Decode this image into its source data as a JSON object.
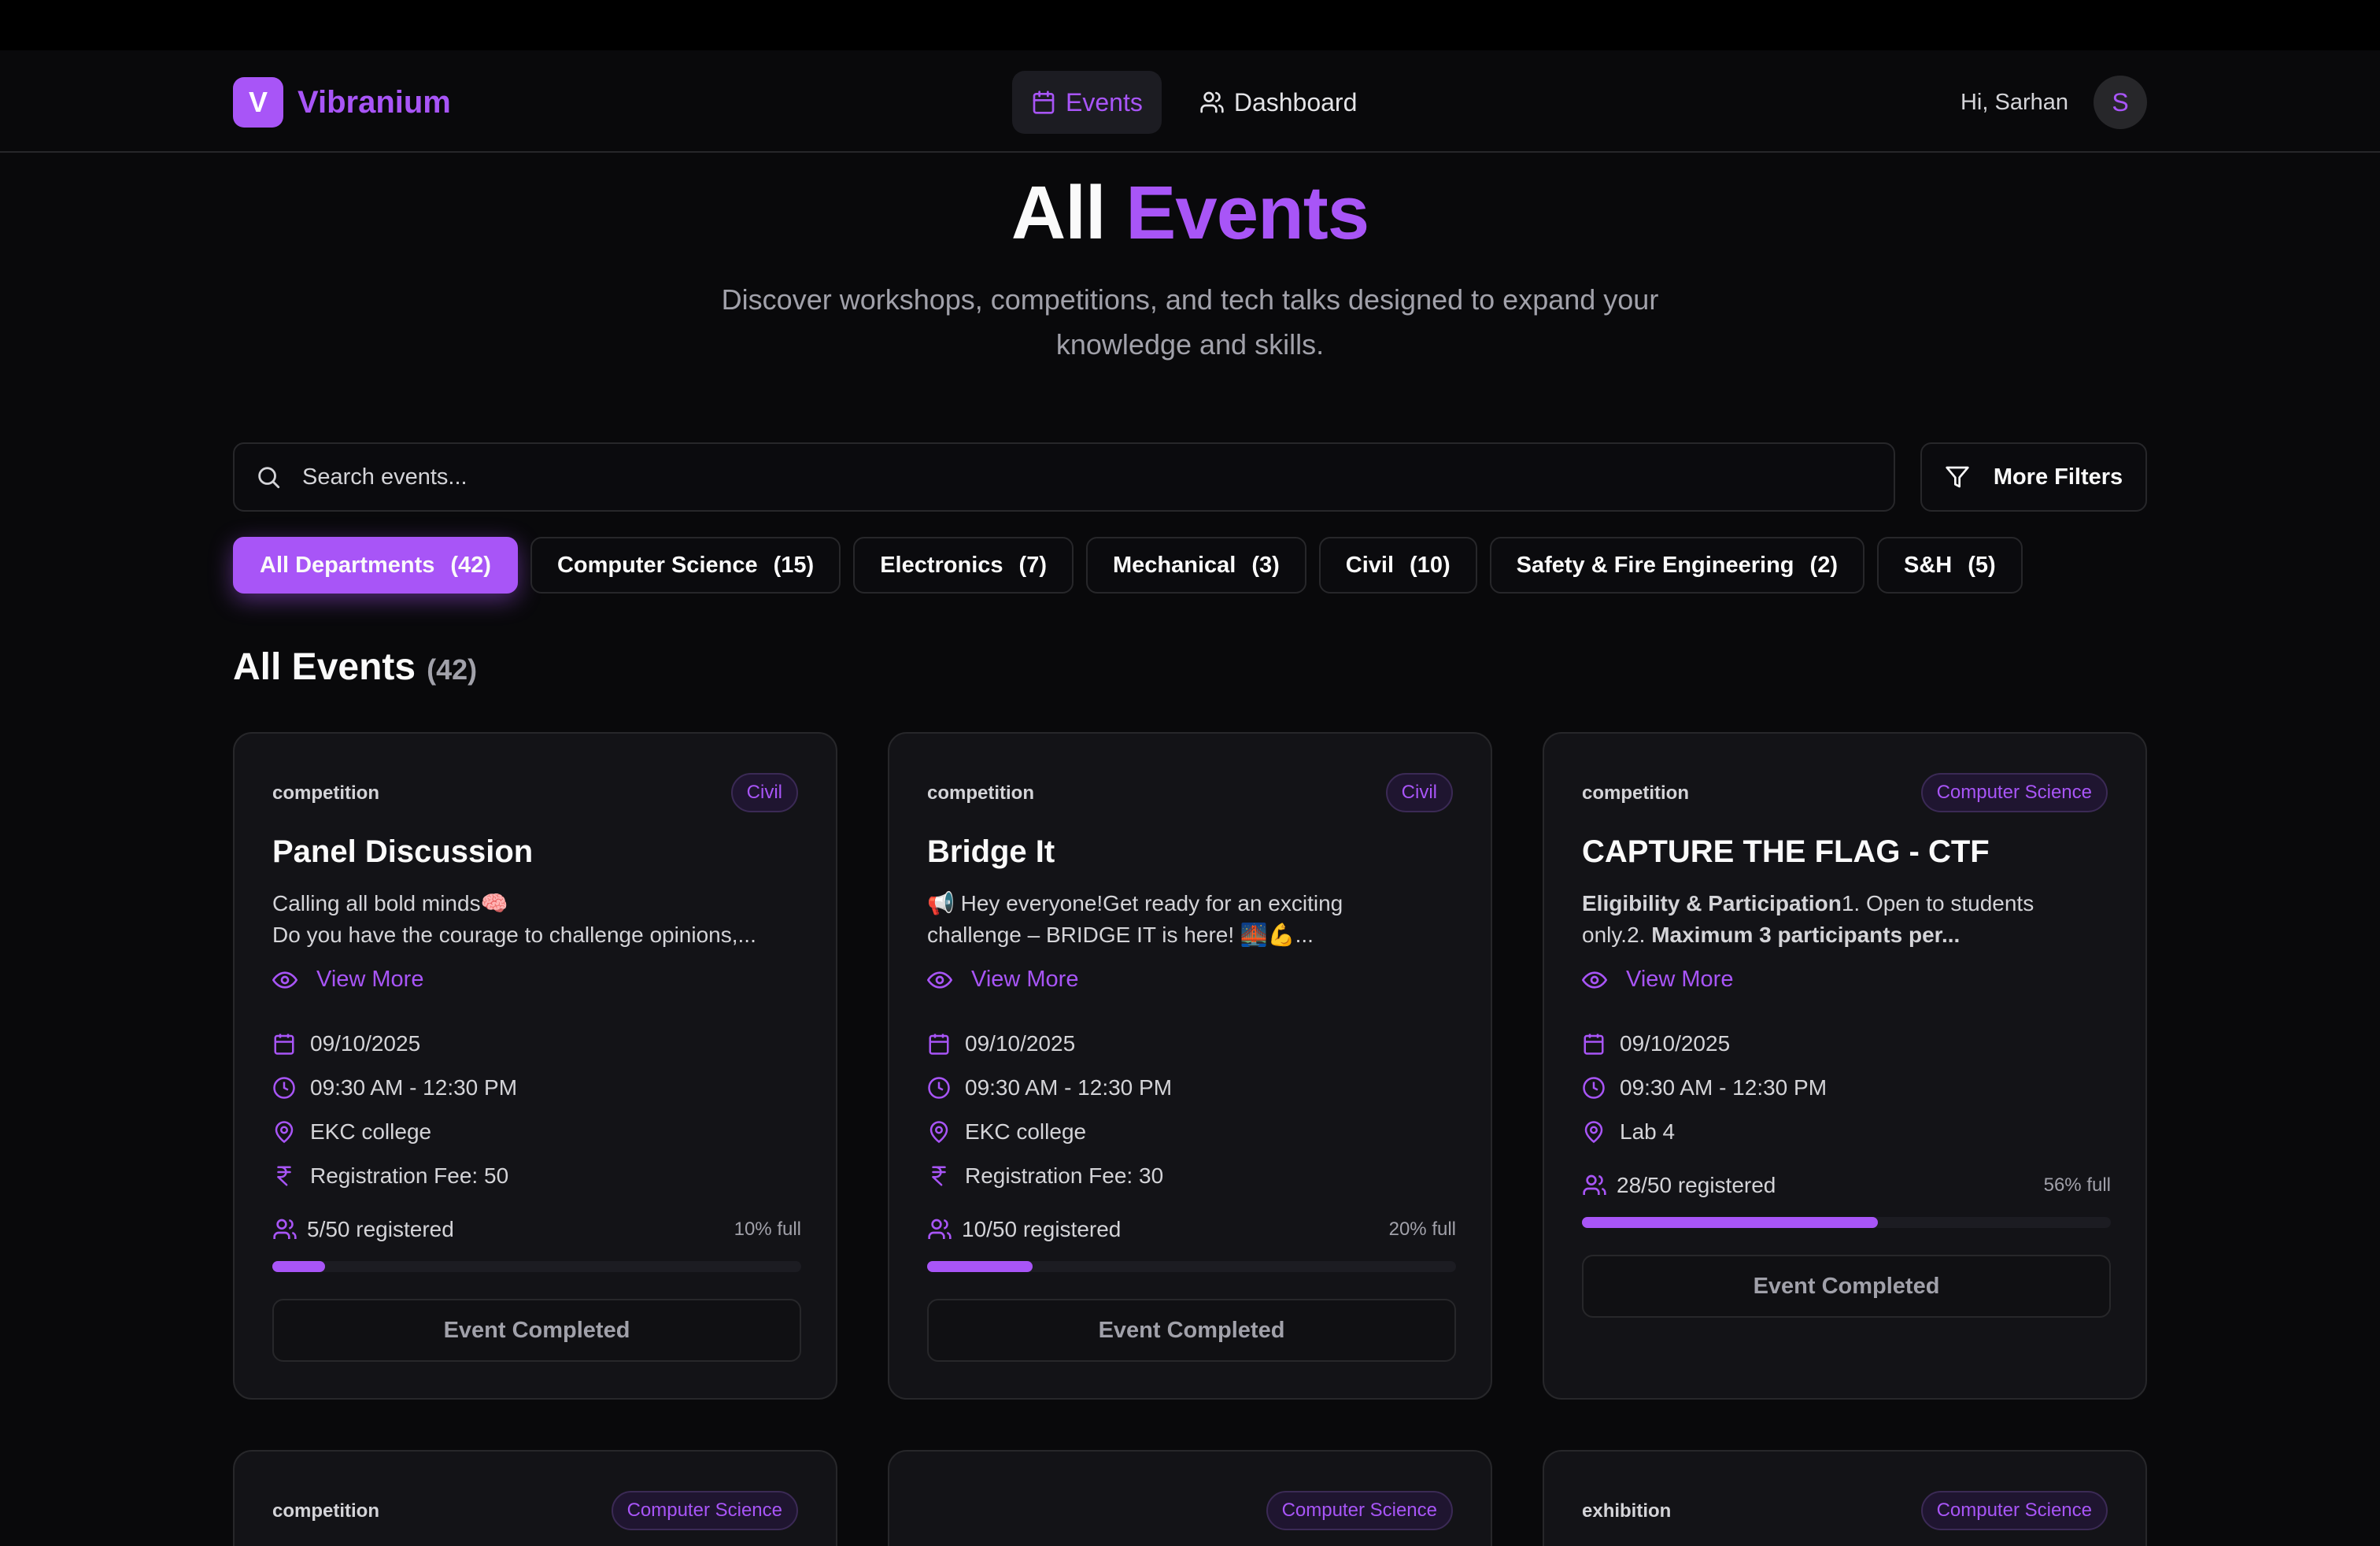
{
  "app": {
    "name": "Vibranium",
    "logo_letter": "V"
  },
  "nav": {
    "events": "Events",
    "dashboard": "Dashboard"
  },
  "user": {
    "greeting": "Hi, Sarhan",
    "initial": "S"
  },
  "hero": {
    "title_prefix": "All",
    "title_highlight": "Events",
    "subtitle": "Discover workshops, competitions, and tech talks designed to expand your knowledge and skills."
  },
  "search": {
    "placeholder": "Search events..."
  },
  "filters": {
    "more_label": "More Filters"
  },
  "departments": [
    {
      "label": "All Departments",
      "count": "(42)"
    },
    {
      "label": "Computer Science",
      "count": "(15)"
    },
    {
      "label": "Electronics",
      "count": "(7)"
    },
    {
      "label": "Mechanical",
      "count": "(3)"
    },
    {
      "label": "Civil",
      "count": "(10)"
    },
    {
      "label": "Safety & Fire Engineering",
      "count": "(2)"
    },
    {
      "label": "S&H",
      "count": "(5)"
    }
  ],
  "section": {
    "title": "All Events",
    "count": "(42)"
  },
  "view_more_label": "View More",
  "events": [
    {
      "type": "competition",
      "department": "Civil",
      "title": "Panel Discussion",
      "desc_line1": "Calling all bold minds🧠",
      "desc_line2": "Do you have the courage to challenge opinions,...",
      "date": "09/10/2025",
      "time": "09:30 AM - 12:30 PM",
      "venue": "EKC college",
      "fee": "Registration Fee: 50",
      "registered": "5/50 registered",
      "full": "10% full",
      "fill_percent": 10,
      "status": "Event Completed"
    },
    {
      "type": "competition",
      "department": "Civil",
      "title": "Bridge It",
      "desc_line1": "📢 Hey everyone!Get ready for an exciting",
      "desc_line2": "challenge – BRIDGE IT is here! 🌉💪...",
      "date": "09/10/2025",
      "time": "09:30 AM - 12:30 PM",
      "venue": "EKC college",
      "fee": "Registration Fee: 30",
      "registered": "10/50 registered",
      "full": "20% full",
      "fill_percent": 20,
      "status": "Event Completed"
    },
    {
      "type": "competition",
      "department": "Computer Science",
      "title": "CAPTURE THE FLAG - CTF",
      "desc_bold1": "Eligibility & Participation",
      "desc_part1": "1.    Open to students",
      "desc_part2": "only.2.    ",
      "desc_bold2": "Maximum 3 participants per...",
      "date": "09/10/2025",
      "time": "09:30 AM - 12:30 PM",
      "venue": "Lab 4",
      "registered": "28/50 registered",
      "full": "56% full",
      "fill_percent": 56,
      "status": "Event Completed"
    },
    {
      "type": "competition",
      "department": "Computer Science"
    },
    {
      "type": "",
      "department": "Computer Science"
    },
    {
      "type": "exhibition",
      "department": "Computer Science"
    }
  ]
}
